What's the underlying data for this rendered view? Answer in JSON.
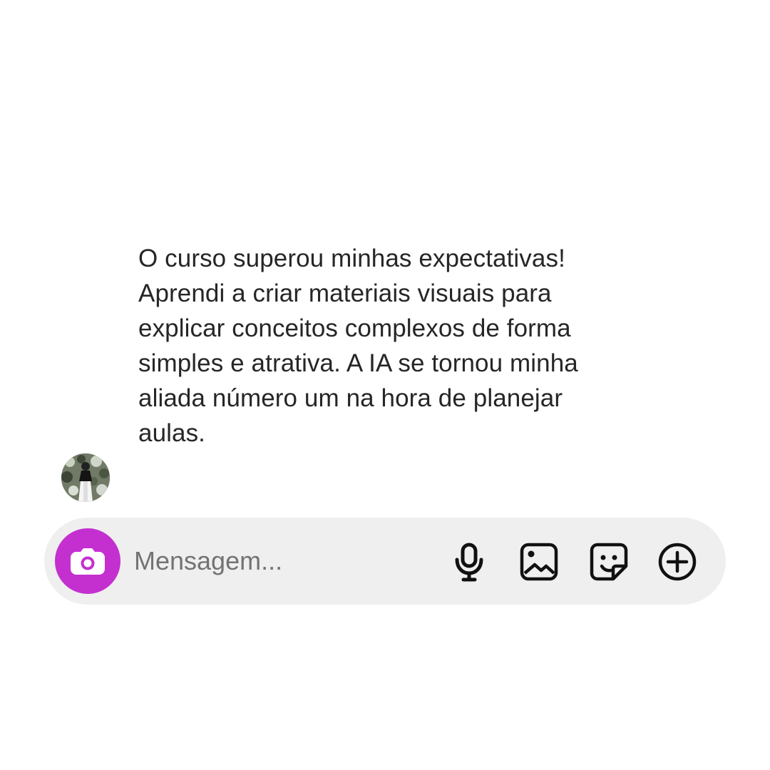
{
  "message": {
    "text": "O curso superou minhas expectativas! Aprendi a criar materiais visuais para explicar conceitos complexos de forma simples e atrativa. A IA se tornou minha aliada número um na hora de planejar aulas."
  },
  "composer": {
    "placeholder": "Mensagem...",
    "camera_icon": "camera-icon",
    "mic_icon": "microphone-icon",
    "gallery_icon": "image-gallery-icon",
    "sticker_icon": "sticker-icon",
    "plus_icon": "plus-circle-icon"
  },
  "colors": {
    "camera_button": "#c330cf",
    "composer_background": "#efefef",
    "text": "#262626",
    "placeholder": "#737373"
  }
}
